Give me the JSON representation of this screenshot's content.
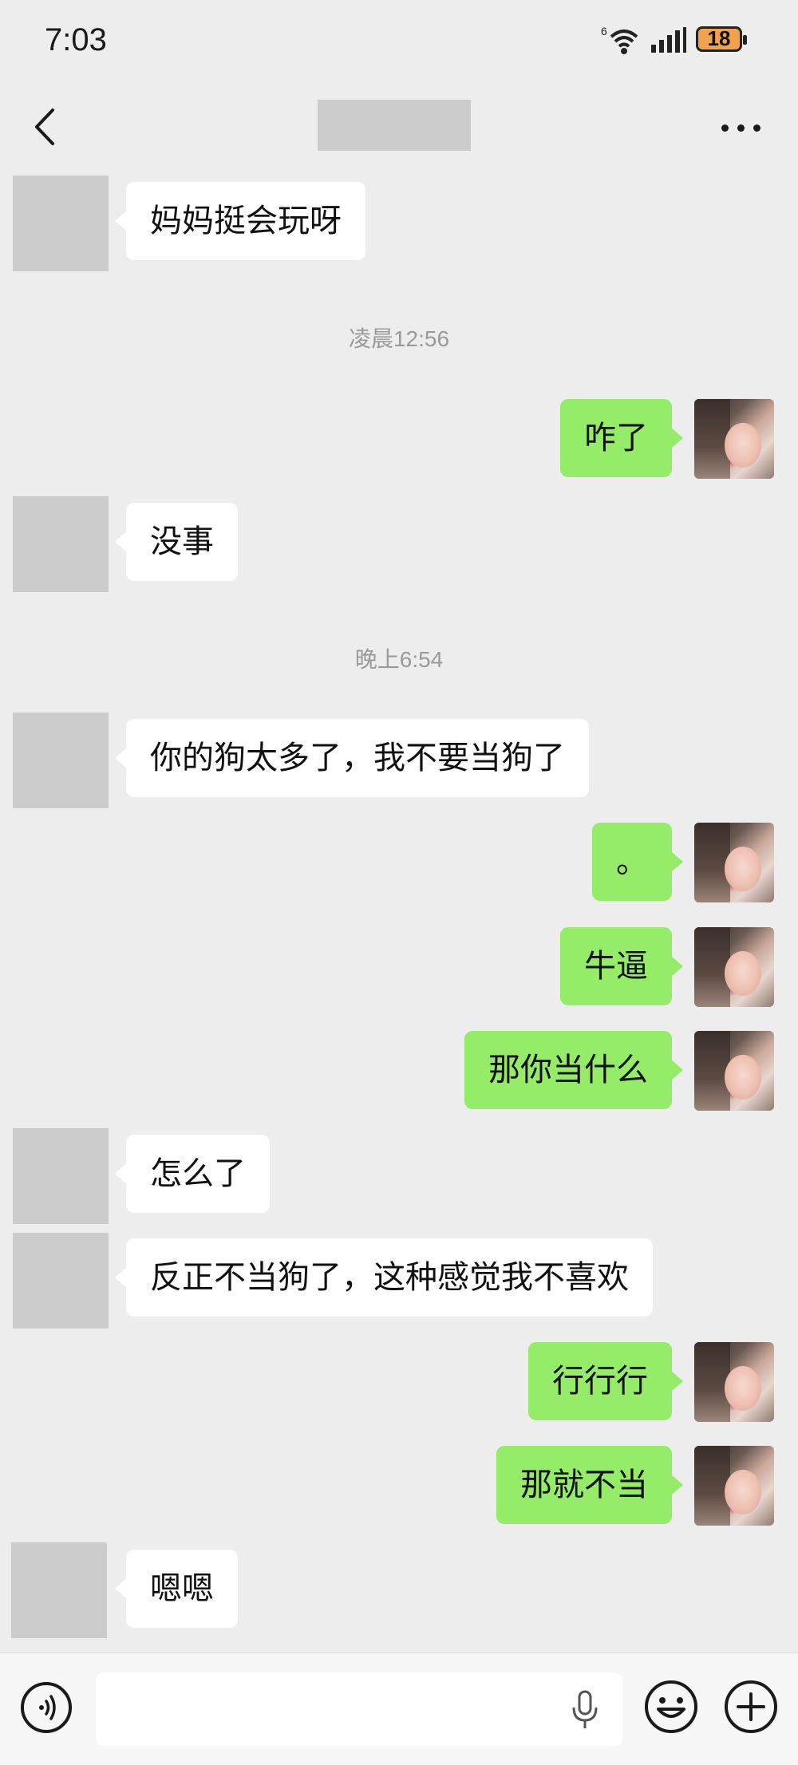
{
  "status_bar": {
    "time": "7:03",
    "network": "6",
    "battery": "18"
  },
  "header": {
    "back_icon": "chevron-left-icon",
    "more_icon": "more-horizontal-icon"
  },
  "messages": [
    {
      "side": "in",
      "text": "妈妈挺会玩呀"
    },
    {
      "type": "timestamp",
      "text": "凌晨12:56"
    },
    {
      "side": "out",
      "text": "咋了"
    },
    {
      "side": "in",
      "text": "没事"
    },
    {
      "type": "timestamp",
      "text": "晚上6:54"
    },
    {
      "side": "in",
      "text": "你的狗太多了，我不要当狗了"
    },
    {
      "side": "out",
      "text": "。"
    },
    {
      "side": "out",
      "text": "牛逼"
    },
    {
      "side": "out",
      "text": "那你当什么"
    },
    {
      "side": "in",
      "text": "怎么了"
    },
    {
      "side": "in",
      "text": "反正不当狗了，这种感觉我不喜欢"
    },
    {
      "side": "out",
      "text": "行行行"
    },
    {
      "side": "out",
      "text": "那就不当"
    },
    {
      "side": "in",
      "text": "嗯嗯"
    }
  ],
  "input_bar": {
    "voice_icon": "voice-icon",
    "mic_icon": "microphone-icon",
    "emoji_icon": "emoji-icon",
    "plus_icon": "plus-icon"
  },
  "colors": {
    "background": "#ededed",
    "outgoing_bubble": "#95ec69",
    "incoming_bubble": "#ffffff"
  }
}
